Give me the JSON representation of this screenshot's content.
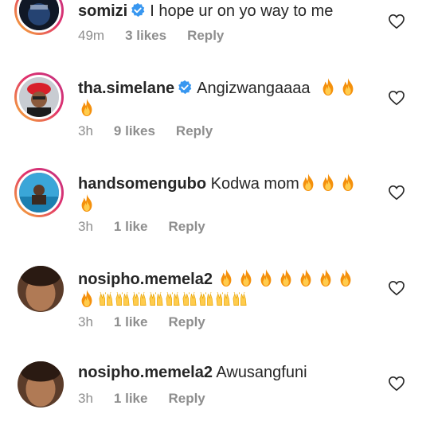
{
  "comments": [
    {
      "username": "somizi",
      "verified": true,
      "text": "I hope ur on yo way to me",
      "time": "49m",
      "likes": "3 likes",
      "reply": "Reply"
    },
    {
      "username": "tha.simelane",
      "verified": true,
      "text": "Angizwangaaaa",
      "emoji": [
        "fire",
        "fire",
        "fire"
      ],
      "time": "3h",
      "likes": "9 likes",
      "reply": "Reply"
    },
    {
      "username": "handsomengubo",
      "verified": false,
      "text": "Kodwa mom",
      "emoji": [
        "fire",
        "fire",
        "fire",
        "fire"
      ],
      "time": "3h",
      "likes": "1 like",
      "reply": "Reply"
    },
    {
      "username": "nosipho.memela2",
      "verified": false,
      "text": "",
      "emoji": [
        "fire",
        "fire",
        "fire",
        "fire",
        "fire",
        "fire",
        "fire",
        "fire",
        "raised-hands",
        "raised-hands",
        "raised-hands",
        "raised-hands",
        "raised-hands",
        "raised-hands",
        "raised-hands",
        "raised-hands",
        "raised-hands"
      ],
      "time": "3h",
      "likes": "1 like",
      "reply": "Reply"
    },
    {
      "username": "nosipho.memela2",
      "verified": false,
      "text": "Awusangfuni",
      "time": "3h",
      "likes": "1 like",
      "reply": "Reply"
    }
  ],
  "icons": {
    "like": "heart-outline-icon",
    "verified": "verified-badge-icon"
  },
  "colors": {
    "verified": "#3897f0",
    "meta": "#8e8e8e",
    "text": "#262626"
  }
}
